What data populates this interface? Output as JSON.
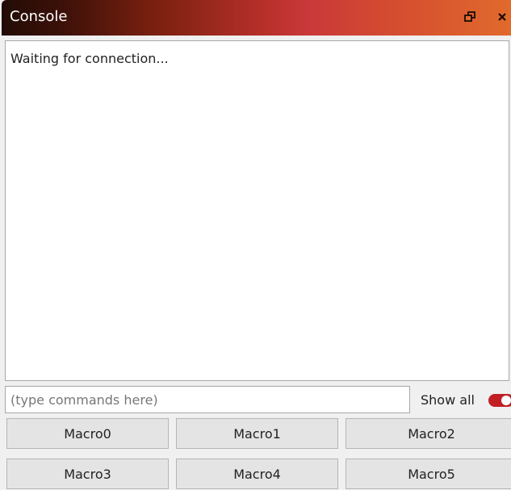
{
  "window": {
    "title": "Console"
  },
  "output": {
    "text": "Waiting for connection..."
  },
  "command": {
    "placeholder": "(type commands here)",
    "value": ""
  },
  "show_all": {
    "label": "Show all",
    "checked": true,
    "color": "#c11f24"
  },
  "macros": [
    "Macro0",
    "Macro1",
    "Macro2",
    "Macro3",
    "Macro4",
    "Macro5"
  ],
  "icons": {
    "float": "float-restore-icon",
    "close": "close-icon"
  }
}
